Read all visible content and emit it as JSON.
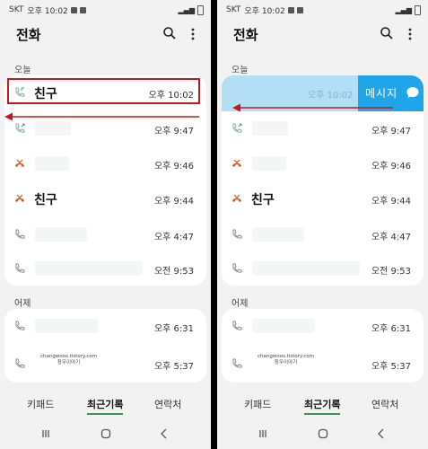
{
  "status": {
    "carrier": "SKT",
    "time": "오후 10:02"
  },
  "app": {
    "title": "전화"
  },
  "sections": {
    "today": "오늘",
    "yesterday": "어제"
  },
  "today_rows": [
    {
      "name": "친구",
      "time": "오후 10:02",
      "icon": "incoming-call-icon"
    },
    {
      "name": "",
      "time": "오후 9:47",
      "icon": "outgoing-call-icon"
    },
    {
      "name": "",
      "time": "오후 9:46",
      "icon": "missed-call-icon"
    },
    {
      "name": "친구",
      "time": "오후 9:44",
      "icon": "missed-call-icon"
    },
    {
      "name": "",
      "time": "오후 4:47",
      "icon": "incoming-call-icon"
    },
    {
      "name": "",
      "time": "오전 9:53",
      "icon": "outgoing-call-icon"
    }
  ],
  "yesterday_rows": [
    {
      "name": "",
      "time": "오후 6:31",
      "icon": "incoming-call-icon"
    },
    {
      "name": "",
      "time": "오후 5:37",
      "icon": "incoming-call-icon"
    }
  ],
  "watermark": {
    "line1": "changwoos.tistory.com",
    "line2": "창우이야기"
  },
  "swipe_action": {
    "label": "메시지",
    "time": "오후 10:02"
  },
  "tabs": {
    "keypad": "키패드",
    "recents": "최근기록",
    "contacts": "연락처"
  },
  "colors": {
    "accent": "#2f9a52",
    "swipe_blue": "#1fa5e8",
    "highlight_red": "#c8161d"
  }
}
